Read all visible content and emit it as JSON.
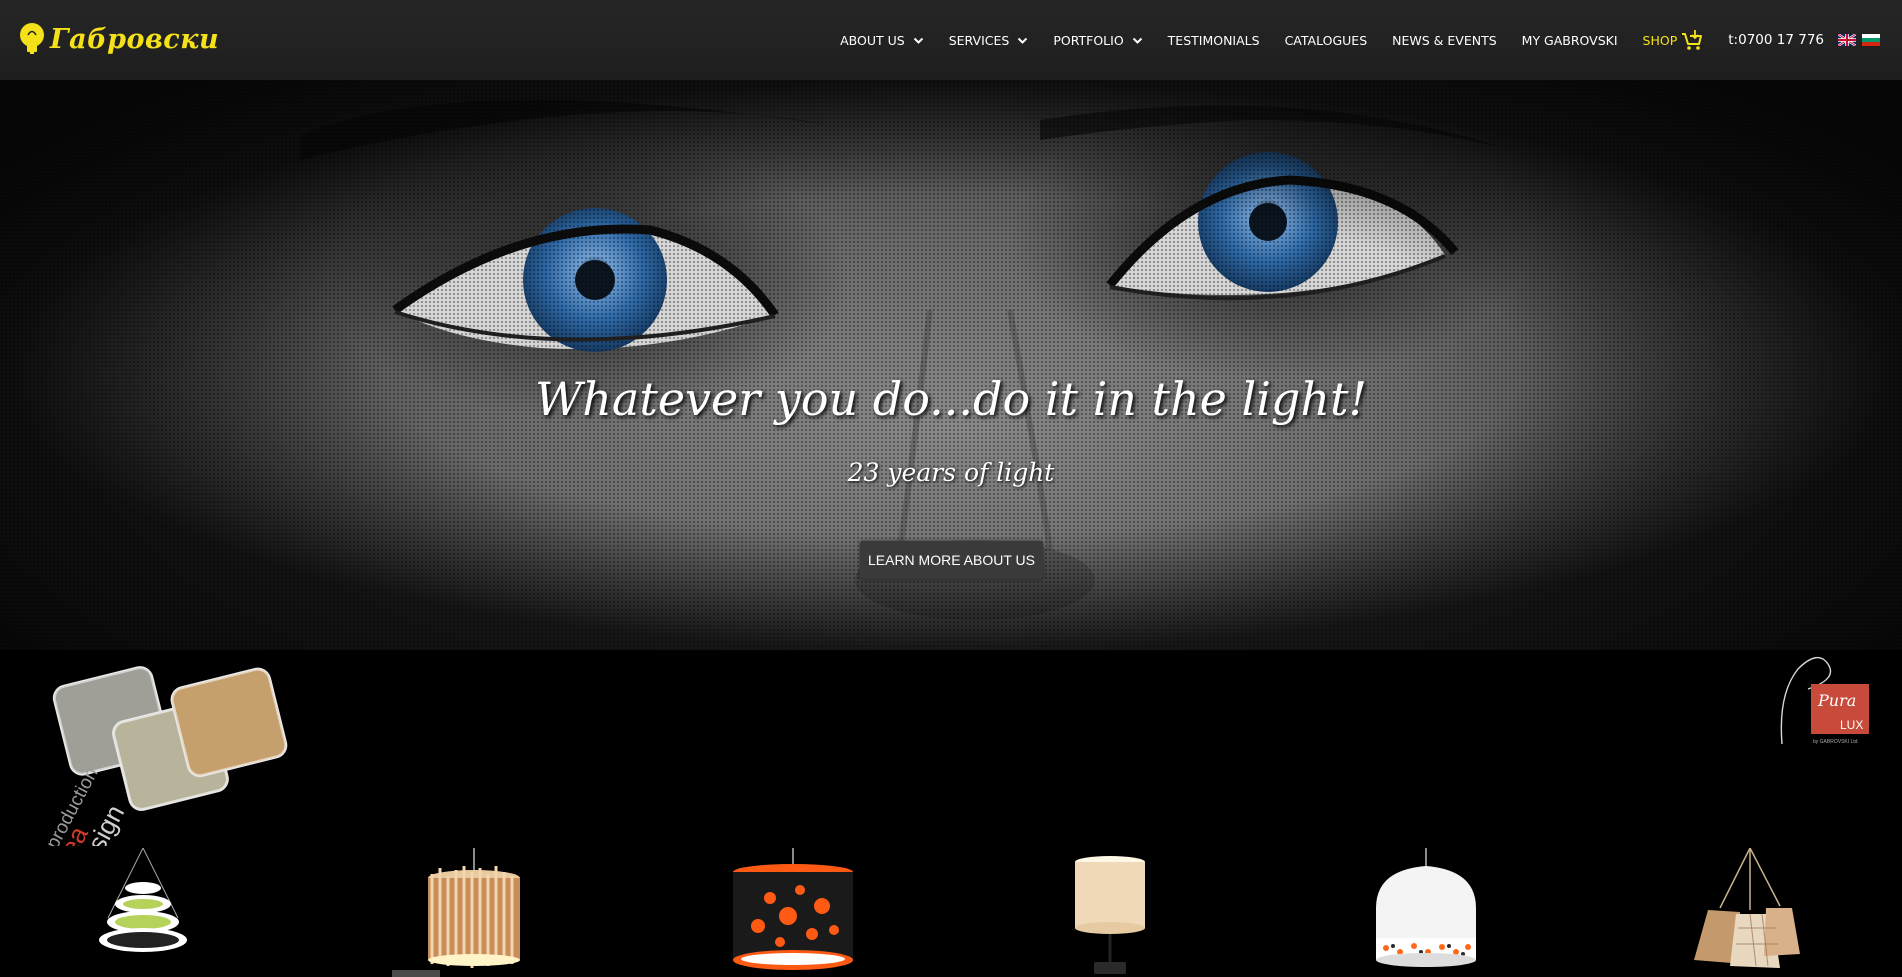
{
  "header": {
    "logo_text": "Габровски",
    "nav": [
      {
        "label": "ABOUT US",
        "has_dropdown": true
      },
      {
        "label": "SERVICES",
        "has_dropdown": true
      },
      {
        "label": "PORTFOLIO",
        "has_dropdown": true
      },
      {
        "label": "TESTIMONIALS",
        "has_dropdown": false
      },
      {
        "label": "CATALOGUES",
        "has_dropdown": false
      },
      {
        "label": "NEWS & EVENTS",
        "has_dropdown": false
      },
      {
        "label": "MY GABROVSKI",
        "has_dropdown": false
      }
    ],
    "shop_label": "SHOP",
    "phone": "t:0700 17 776",
    "languages": [
      "en",
      "bg"
    ]
  },
  "hero": {
    "title": "Whatever you do...do it in the light!",
    "subtitle": "23 years of light",
    "button_label": "LEARN MORE ABOUT US"
  },
  "brands": {
    "left_logo_text": "production",
    "left_logo_words": [
      "Idea",
      "design"
    ],
    "right_logo_script": "Pura",
    "right_logo_text": "LUX",
    "right_logo_sub": "by GABROVSKI Ltd"
  },
  "products": [
    {
      "icon": "ring-pendant-lamp-icon"
    },
    {
      "icon": "wood-slat-chandelier-icon"
    },
    {
      "icon": "black-orange-drum-lamp-icon"
    },
    {
      "icon": "cream-table-lamp-icon"
    },
    {
      "icon": "white-dome-pendant-icon"
    },
    {
      "icon": "fabric-cluster-pendant-icon"
    }
  ],
  "colors": {
    "brand_yellow": "#f5e11a",
    "header_bg": "#222222",
    "eye_blue": "#2e6aa8",
    "accent_orange": "#ff5a14",
    "accent_red": "#d23a2a"
  }
}
